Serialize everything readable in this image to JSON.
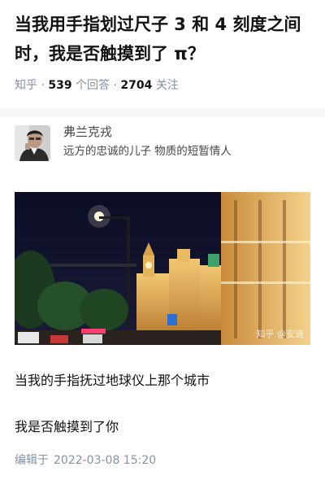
{
  "question": {
    "title": "当我用手指划过尺子 3 和 4 刻度之间时，我是否触摸到了 π？",
    "site": "知乎",
    "answers_count": "539",
    "answers_label": "个回答",
    "followers_count": "2704",
    "followers_label": "关注"
  },
  "author": {
    "name": "弗兰克戎",
    "bio": "远方的忠诚的儿子 物质的短暂情人",
    "avatar_icon": "portrait-avatar"
  },
  "image": {
    "watermark": "知乎 @安迪"
  },
  "answer": {
    "paragraphs": [
      "当我的手指抚过地球仪上那个城市",
      "我是否触摸到了你"
    ],
    "edit_label": "编辑于",
    "edit_time": "2022-03-08 15:20"
  }
}
